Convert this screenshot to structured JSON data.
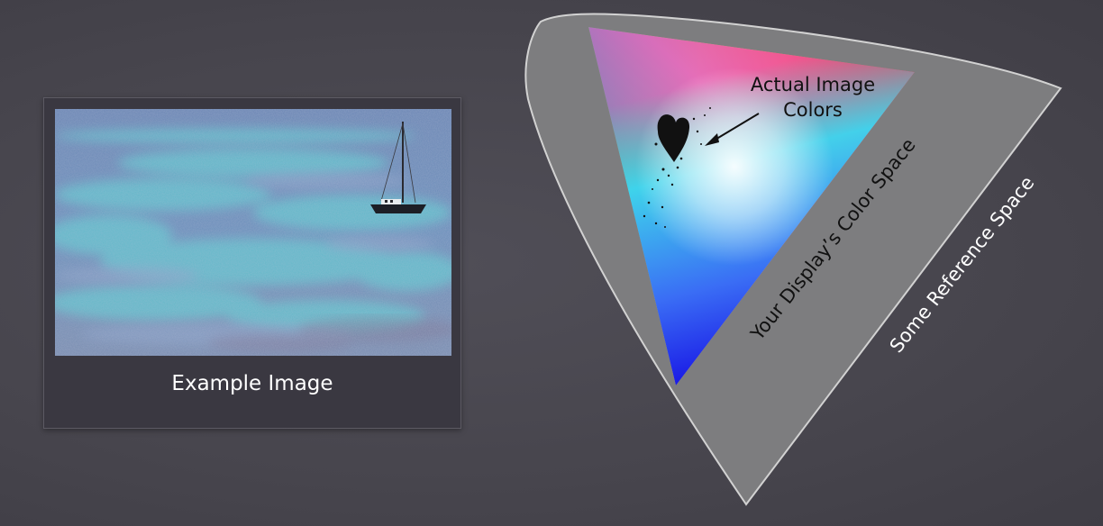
{
  "example_image": {
    "caption": "Example Image"
  },
  "diagram": {
    "actual_colors_label_line1": "Actual Image",
    "actual_colors_label_line2": "Colors",
    "display_space_label": "Your Display’s Color Space",
    "reference_space_label": "Some Reference Space"
  }
}
